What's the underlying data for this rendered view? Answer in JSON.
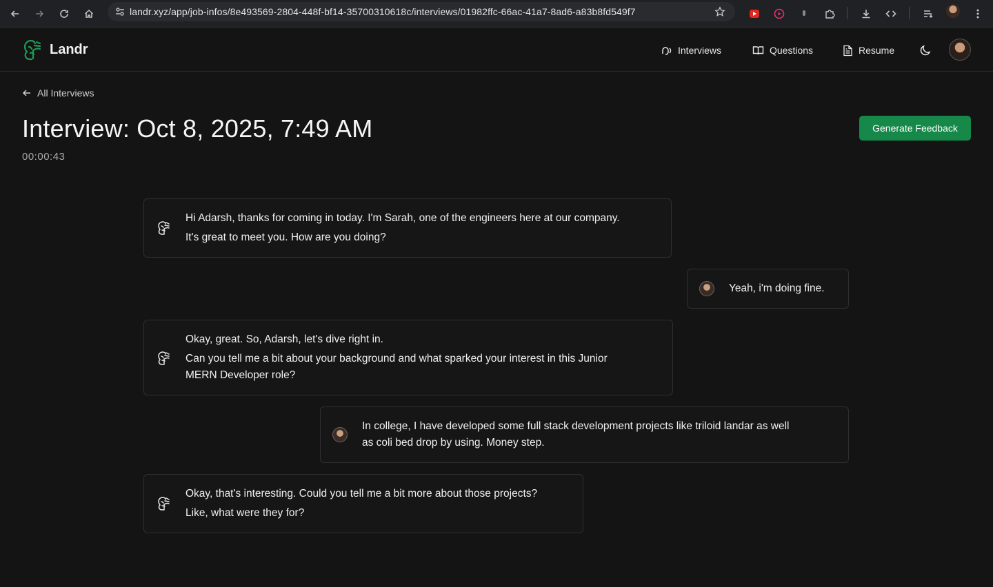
{
  "browser": {
    "url": "landr.xyz/app/job-infos/8e493569-2804-448f-bf14-35700310618c/interviews/01982ffc-66ac-41a7-8ad6-a83b8fd549f7"
  },
  "header": {
    "logo_text": "Landr",
    "nav": {
      "interviews": "Interviews",
      "questions": "Questions",
      "resume": "Resume"
    }
  },
  "main": {
    "back_label": "All Interviews",
    "title": "Interview: Oct 8, 2025, 7:49 AM",
    "timer": "00:00:43",
    "generate_feedback": "Generate Feedback"
  },
  "messages": [
    {
      "role": "interviewer",
      "lines": [
        "Hi Adarsh, thanks for coming in today. I'm Sarah, one of the engineers here at our company.",
        "It's great to meet you. How are you doing?"
      ]
    },
    {
      "role": "user",
      "lines": [
        "Yeah, i'm doing fine."
      ]
    },
    {
      "role": "interviewer",
      "lines": [
        "Okay, great. So, Adarsh, let's dive right in.",
        "Can you tell me a bit about your background and what sparked your interest in this Junior",
        "MERN Developer role?"
      ]
    },
    {
      "role": "user",
      "lines": [
        "In college, I have developed some full stack development projects like triloid landar as well",
        "as coli bed drop by using. Money step."
      ]
    },
    {
      "role": "interviewer",
      "lines": [
        "Okay, that's interesting. Could you tell me a bit more about those projects?",
        "Like, what were they for?"
      ]
    }
  ],
  "colors": {
    "accent": "#16884a",
    "logo": "#1f9a55",
    "background": "#141414"
  }
}
